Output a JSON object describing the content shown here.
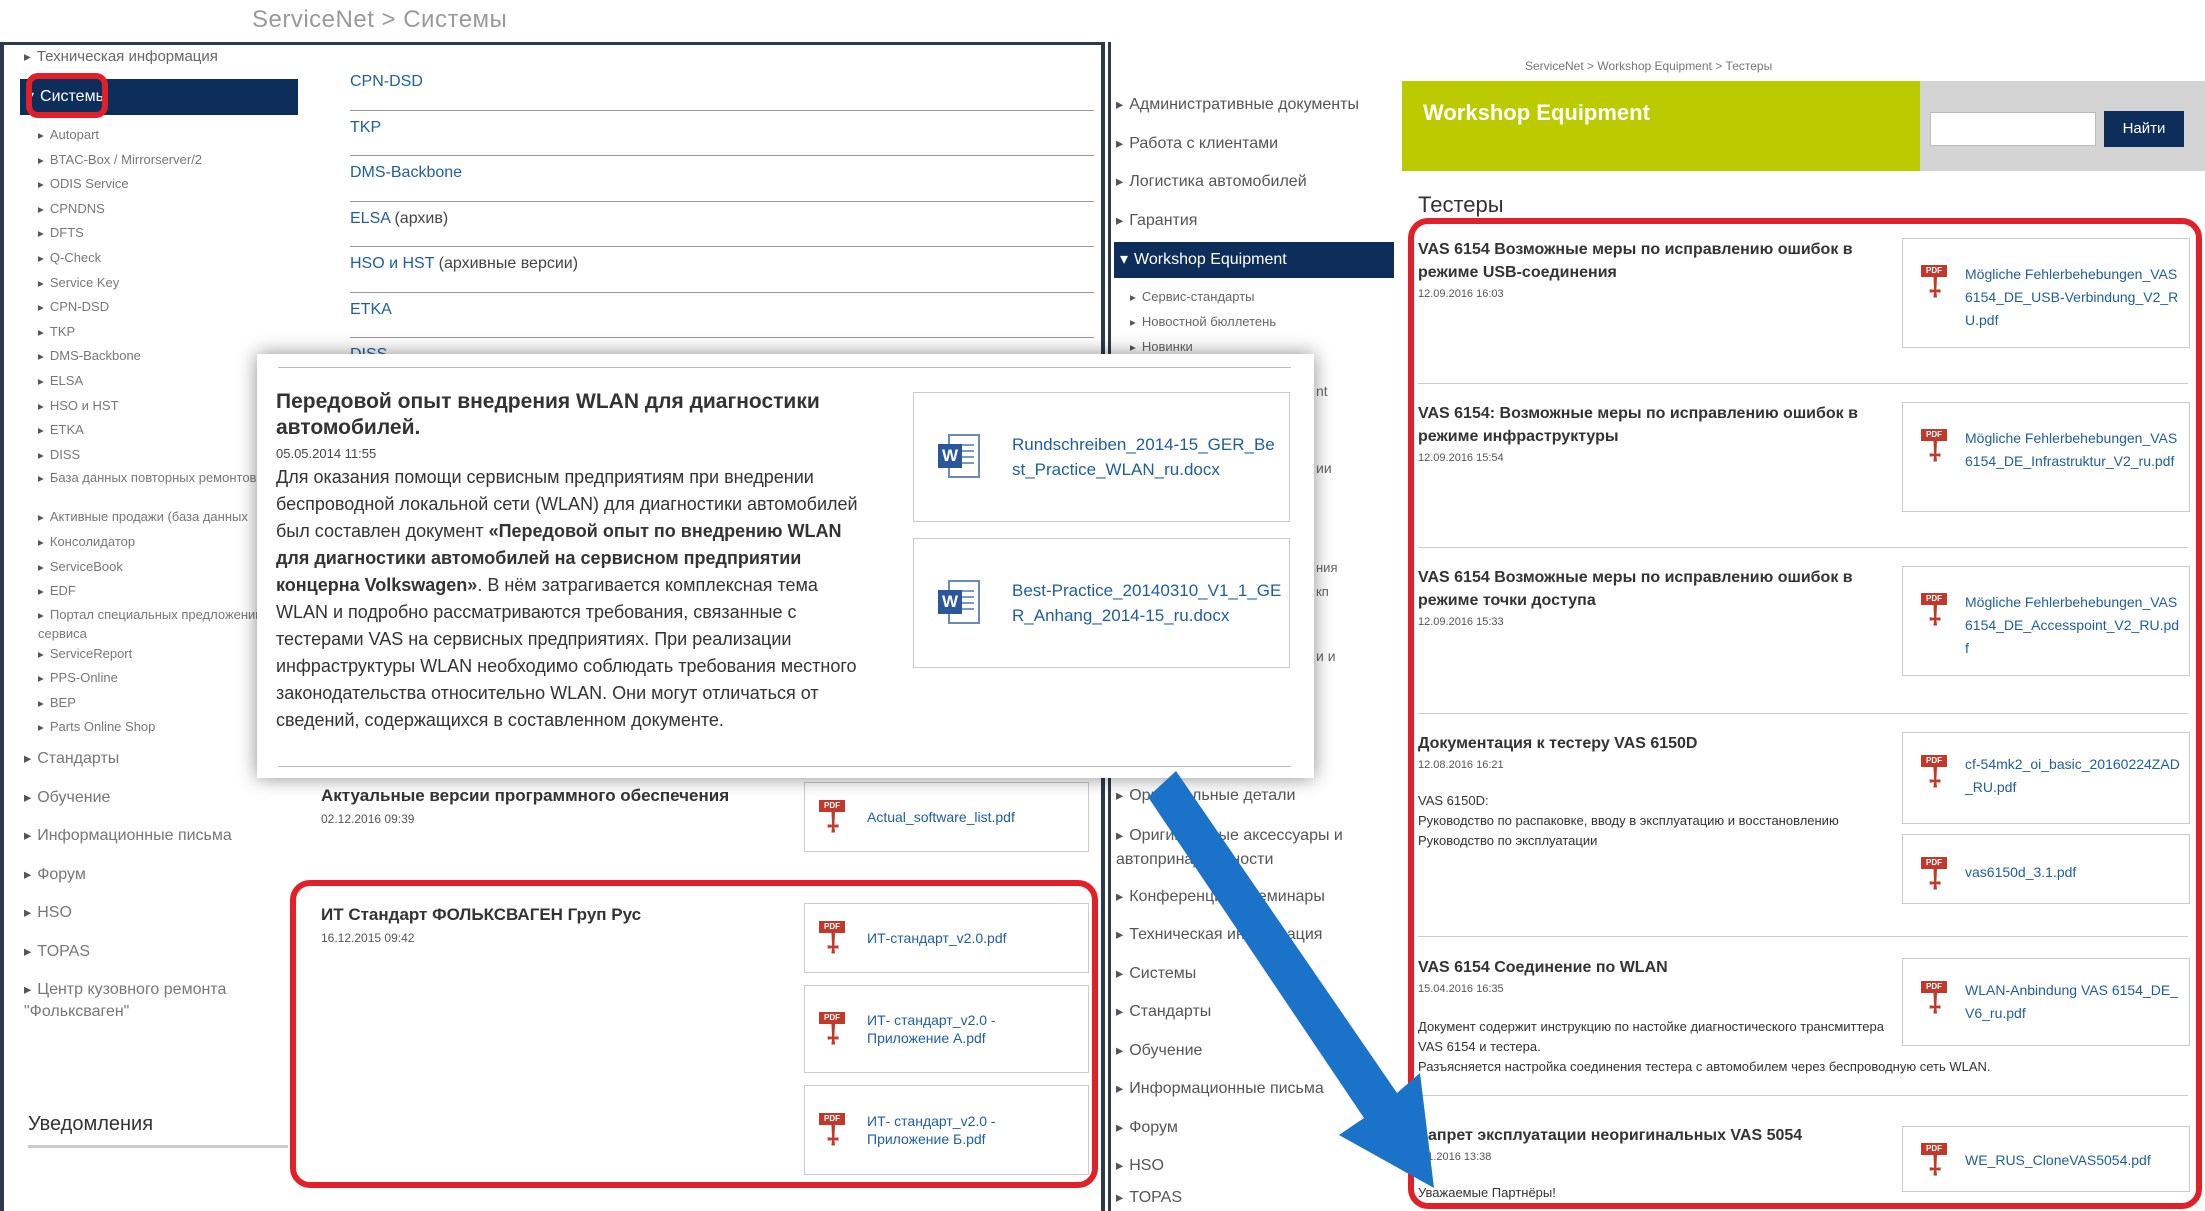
{
  "left": {
    "breadcrumb": "ServiceNet > Системы",
    "nav_top": "Техническая информация",
    "nav_active": "Системы",
    "nav_subs": [
      "Autopart",
      "BTAC-Box / Mirrorserver/2",
      "ODIS Service",
      "CPNDNS",
      "DFTS",
      "Q-Check",
      "Service Key",
      "CPN-DSD",
      "TKP",
      "DMS-Backbone",
      "ELSA",
      "HSO и HST",
      "ETKA",
      "DISS"
    ],
    "nav_sub_twoline_1": "База данных повторных ремонтов CSS",
    "nav_subs_2": [
      "Активные продажи (база данных"
    ],
    "nav_subs_3": [
      "Консолидатор",
      "ServiceBook",
      "EDF"
    ],
    "nav_sub_twoline_2": "Портал специальных предложений сервиса",
    "nav_subs_4": [
      "ServiceReport",
      "PPS-Online",
      "BEP",
      "Parts Online Shop"
    ],
    "nav_main": [
      "Стандарты",
      "Обучение",
      "Информационные письма",
      "Форум",
      "HSO",
      "TOPAS"
    ],
    "nav_main_twoline": "Центр кузовного ремонта \"Фольксваген\"",
    "notifications_title": "Уведомления",
    "systems": [
      {
        "name": "CPN-DSD",
        "note": ""
      },
      {
        "name": "TKP",
        "note": ""
      },
      {
        "name": "DMS-Backbone",
        "note": ""
      },
      {
        "name": "ELSA",
        "note": " (архив)"
      },
      {
        "name": "HSO и HST",
        "note": " (архивные версии)"
      },
      {
        "name": "ETKA",
        "note": ""
      },
      {
        "name": "DISS",
        "note": ""
      }
    ],
    "article_software": {
      "title": "Актуальные версии программного обеспечения",
      "date": "02.12.2016 09:39",
      "file": "Actual_software_list.pdf"
    },
    "article_it": {
      "title": "ИТ Стандарт ФОЛЬКСВАГЕН Груп Рус",
      "date": "16.12.2015 09:42",
      "files": [
        "ИТ-стандарт_v2.0.pdf",
        "ИТ- стандарт_v2.0 - Приложение А.pdf",
        "ИТ- стандарт_v2.0 - Приложение Б.pdf"
      ]
    }
  },
  "popup": {
    "title": "Передовой опыт внедрения WLAN для диагностики автомобилей.",
    "date": "05.05.2014 11:55",
    "body_1": "Для оказания помощи сервисным предприятиям при внедрении беспроводной локальной сети (WLAN) для диагностики автомобилей был составлен документ ",
    "body_bold": "«Передовой опыт по внедрению WLAN для диагностики автомобилей на сервисном предприятии концерна Volkswagen»",
    "body_2": ". В нём затрагивается комплексная тема WLAN и подробно рассматриваются требования, связанные с тестерами VAS на сервисных предприятиях. При реализации инфраструктуры WLAN необходимо соблюдать требования местного законодательства относительно WLAN. Они могут отличаться от сведений, содержащихся в составленном документе.",
    "files": [
      "Rundschreiben_2014-15_GER_Best_Practice_WLAN_ru.docx",
      "Best-Practice_20140310_V1_1_GER_Anhang_2014-15_ru.docx"
    ]
  },
  "right": {
    "breadcrumb": "ServiceNet > Workshop Equipment > Тестеры",
    "nav_main_1": [
      "Административные документы",
      "Работа с клиентами",
      "Логистика автомобилей",
      "Гарантия"
    ],
    "nav_active": "Workshop Equipment",
    "nav_subs": [
      "Сервис-стандарты",
      "Новостной бюллетень",
      "Новинки"
    ],
    "nav_partial": [
      "nt",
      "ии",
      "ния",
      "кп",
      "и и"
    ],
    "nav_main_2": [
      "Оригинальные детали"
    ],
    "nav_main_twoline": "Оригинальные аксессуары и автопринадлежности",
    "nav_main_3": [
      "Конференции и семинары",
      "Техническая информация",
      "Системы",
      "Стандарты",
      "Обучение",
      "Информационные письма",
      "Форум",
      "HSO",
      "TOPAS"
    ],
    "banner_title": "Workshop Equipment",
    "search_button": "Найти",
    "search_placeholder": "",
    "section_title": "Тестеры",
    "items": [
      {
        "title": "VAS 6154 Возможные меры по исправлению ошибок в режиме USB-соединения",
        "date": "12.09.2016 16:03",
        "files": [
          "Mögliche Fehlerbehebungen_VAS6154_DE_USB-Verbindung_V2_RU.pdf"
        ]
      },
      {
        "title": "VAS 6154: Возможные меры по исправлению ошибок в режиме инфраструктуры",
        "date": "12.09.2016 15:54",
        "files": [
          "Mögliche Fehlerbehebungen_VAS6154_DE_Infrastruktur_V2_ru.pdf"
        ]
      },
      {
        "title": "VAS 6154 Возможные меры по исправлению ошибок в режиме точки доступа",
        "date": "12.09.2016 15:33",
        "files": [
          "Mögliche Fehlerbehebungen_VAS6154_DE_Accesspoint_V2_RU.pdf"
        ]
      },
      {
        "title": "Документация к тестеру VAS 6150D",
        "date": "12.08.2016 16:21",
        "text_1": "VAS 6150D:",
        "text_2": "Руководство по распаковке, вводу в эксплуатацию и восстановлению",
        "text_3": "Руководство по эксплуатации",
        "files": [
          "cf-54mk2_oi_basic_20160224ZAD_RU.pdf",
          "vas6150d_3.1.pdf"
        ]
      },
      {
        "title": "VAS 6154 Соединение по WLAN",
        "date": "15.04.2016 16:35",
        "text_1": "Документ содержит инструкцию по настойке диагностического трансмиттера  VAS 6154 и тестера.",
        "text_2": "Разъясняется настройка соединения тестера с автомобилем через беспроводную сеть WLAN.",
        "files": [
          "WLAN-Anbindung VAS 6154_DE_V6_ru.pdf"
        ]
      },
      {
        "title": "Запрет эксплуатации неоригинальных VAS 5054",
        "date": ".01.2016 13:38",
        "text_1": "Уважаемые Партнёры!",
        "files": [
          "WE_RUS_CloneVAS5054.pdf"
        ]
      }
    ]
  },
  "colors": {
    "nav_active_bg": "#0d2d5a",
    "banner_bg": "#bccb00",
    "highlight": "#e2202a",
    "arrow": "#1a72c9",
    "link": "#1f5e9e"
  }
}
